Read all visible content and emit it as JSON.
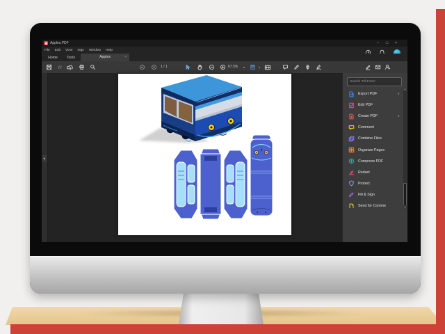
{
  "window": {
    "title": "Apples.PDF",
    "controls": {
      "minimize": "–",
      "maximize": "□",
      "close": "×"
    }
  },
  "menu_bar": {
    "items": [
      "File",
      "Edit",
      "View",
      "Sign",
      "Window",
      "Help"
    ]
  },
  "tab_bar": {
    "home": "Home",
    "tools": "Tools",
    "document_tab": {
      "label": "Apples",
      "close": "×"
    }
  },
  "toolbar": {
    "page_current": "1",
    "page_divider": "/",
    "page_total": "1",
    "zoom_level": "67.5%"
  },
  "tools_panel": {
    "search_placeholder": "Search 'Fill Form'",
    "items": [
      {
        "label": "Export PDF",
        "expandable": true
      },
      {
        "label": "Edit PDF",
        "expandable": false
      },
      {
        "label": "Create PDF",
        "expandable": true
      },
      {
        "label": "Comment",
        "expandable": false
      },
      {
        "label": "Combine Files",
        "expandable": false
      },
      {
        "label": "Organize Pages",
        "expandable": false
      },
      {
        "label": "Compress PDF",
        "expandable": false
      },
      {
        "label": "Redact",
        "expandable": false
      },
      {
        "label": "Protect",
        "expandable": false
      },
      {
        "label": "Fill & Sign",
        "expandable": false
      },
      {
        "label": "Send for Comme",
        "expandable": false
      }
    ]
  },
  "icons": {
    "star": "☆",
    "caret_down": "▼",
    "chevron_down": "∨",
    "scroll_up": "▲",
    "scroll_down": "▼",
    "panel_toggle": "▸"
  },
  "colors": {
    "accent_blue": "#3f97f6",
    "background_red": "#ce4136",
    "desk_tan": "#ecd09b",
    "avatar_cyan": "#2cb9dd",
    "artwork_bus_navy": "#15336f",
    "artwork_bus_blue": "#1c4cb2",
    "artwork_template_blue": "#4c60ce",
    "artwork_window_cyan": "#a7e0f6",
    "artwork_eye_yellow": "#f2cf1d"
  }
}
